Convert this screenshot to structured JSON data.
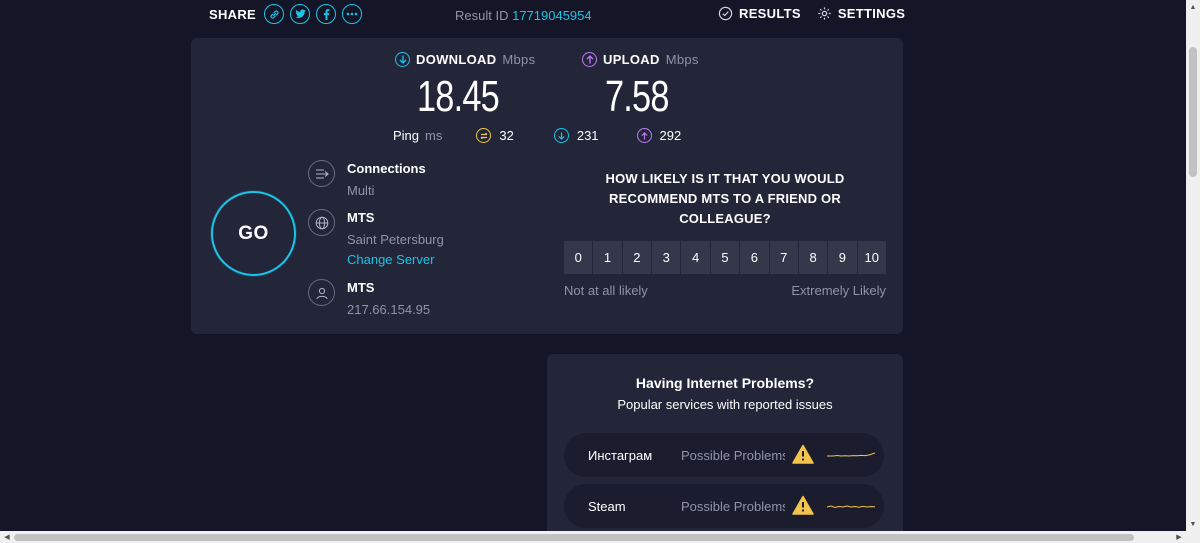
{
  "header": {
    "share_label": "SHARE",
    "share_buttons": [
      {
        "icon": "link-icon",
        "glyph": "🔗"
      },
      {
        "icon": "twitter-icon",
        "glyph": "t"
      },
      {
        "icon": "facebook-icon",
        "glyph": "f"
      },
      {
        "icon": "more-icon",
        "glyph": "•••"
      }
    ],
    "result_id_label": "Result ID",
    "result_id_value": "17719045954",
    "results_label": "RESULTS",
    "settings_label": "SETTINGS"
  },
  "metrics": {
    "download": {
      "label": "DOWNLOAD",
      "unit": "Mbps",
      "value": "18.45",
      "color": "#1bc4e8"
    },
    "upload": {
      "label": "UPLOAD",
      "unit": "Mbps",
      "value": "7.58",
      "color": "#c07bf2"
    }
  },
  "ping": {
    "label": "Ping",
    "unit": "ms",
    "idle": "32",
    "download": "231",
    "upload": "292",
    "idle_color": "#f3c44b"
  },
  "go_button": {
    "label": "GO"
  },
  "connections": {
    "title": "Connections",
    "value": "Multi"
  },
  "server": {
    "title": "MTS",
    "location": "Saint Petersburg",
    "change_label": "Change Server"
  },
  "provider": {
    "title": "MTS",
    "ip": "217.66.154.95"
  },
  "survey": {
    "question": "HOW LIKELY IS IT THAT YOU WOULD RECOMMEND MTS TO A FRIEND OR COLLEAGUE?",
    "options": [
      "0",
      "1",
      "2",
      "3",
      "4",
      "5",
      "6",
      "7",
      "8",
      "9",
      "10"
    ],
    "low_label": "Not at all likely",
    "high_label": "Extremely Likely"
  },
  "problems": {
    "title": "Having Internet Problems?",
    "subtitle": "Popular services with reported issues",
    "services": [
      {
        "name": "Инстаграм",
        "status": "Possible Problems"
      },
      {
        "name": "Steam",
        "status": "Possible Problems"
      }
    ],
    "warn_color": "#f3c44b"
  }
}
